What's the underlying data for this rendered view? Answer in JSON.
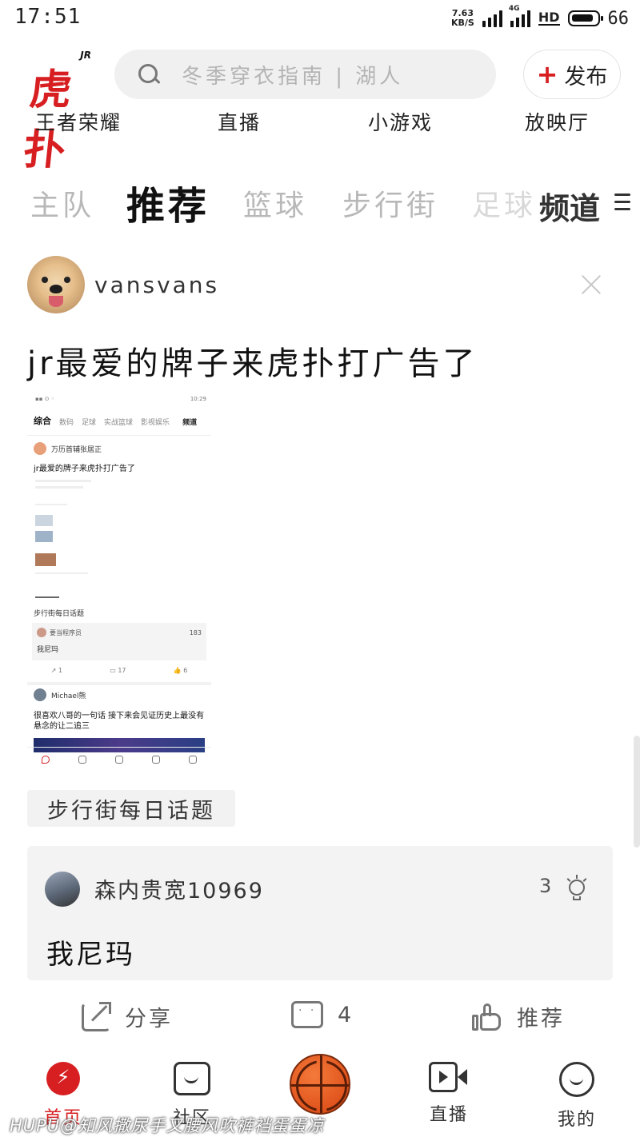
{
  "status_bar": {
    "time": "17:51",
    "net_speed_value": "7.63",
    "net_speed_unit": "KB/S",
    "network_tag": "4G",
    "hd_label": "HD",
    "battery_level": "66"
  },
  "header": {
    "logo_badge": "JR",
    "logo_text": "虎扑",
    "search_placeholder": "冬季穿衣指南 | 湖人",
    "publish_label": "发布",
    "brand_color": "#d71f22"
  },
  "quick_links": [
    "王者荣耀",
    "直播",
    "小游戏",
    "放映厅"
  ],
  "tabs": {
    "items": [
      "主队",
      "推荐",
      "篮球",
      "步行街",
      "足球"
    ],
    "active_index": 1,
    "channel_label": "频道"
  },
  "post": {
    "username": "vansvans",
    "title": "jr最爱的牌子来虎扑打广告了",
    "embedded_screenshot": {
      "status_time": "10:29",
      "tabs": [
        "综合",
        "数码",
        "足球",
        "实战篮球",
        "影视娱乐"
      ],
      "channel_label": "频道",
      "user": "万历首辅张居正",
      "title": "jr最爱的牌子来虎扑打广告了",
      "topic": "步行街每日话题",
      "reply_user": "要当程序员",
      "reply_count": "183",
      "reply_text": "我尼玛",
      "share_count": "1",
      "comment_count": "17",
      "like_count": "6",
      "post2_user": "Michael熊",
      "post2_text": "很喜欢八哥的一句话 接下来会见证历史上最没有悬念的让二追三"
    },
    "topic_tag": "步行街每日话题",
    "top_reply": {
      "username": "森内贵宽10969",
      "light_count": "3",
      "text": "我尼玛"
    },
    "actions": {
      "share_label": "分享",
      "comment_count": "4",
      "recommend_label": "推荐"
    }
  },
  "bottom_nav": {
    "items": [
      "首页",
      "社区",
      "",
      "直播",
      "我的"
    ],
    "active_index": 0
  },
  "watermark": "HUPU@知风撒尿手又腰风吹裤裆蛋蛋凉"
}
